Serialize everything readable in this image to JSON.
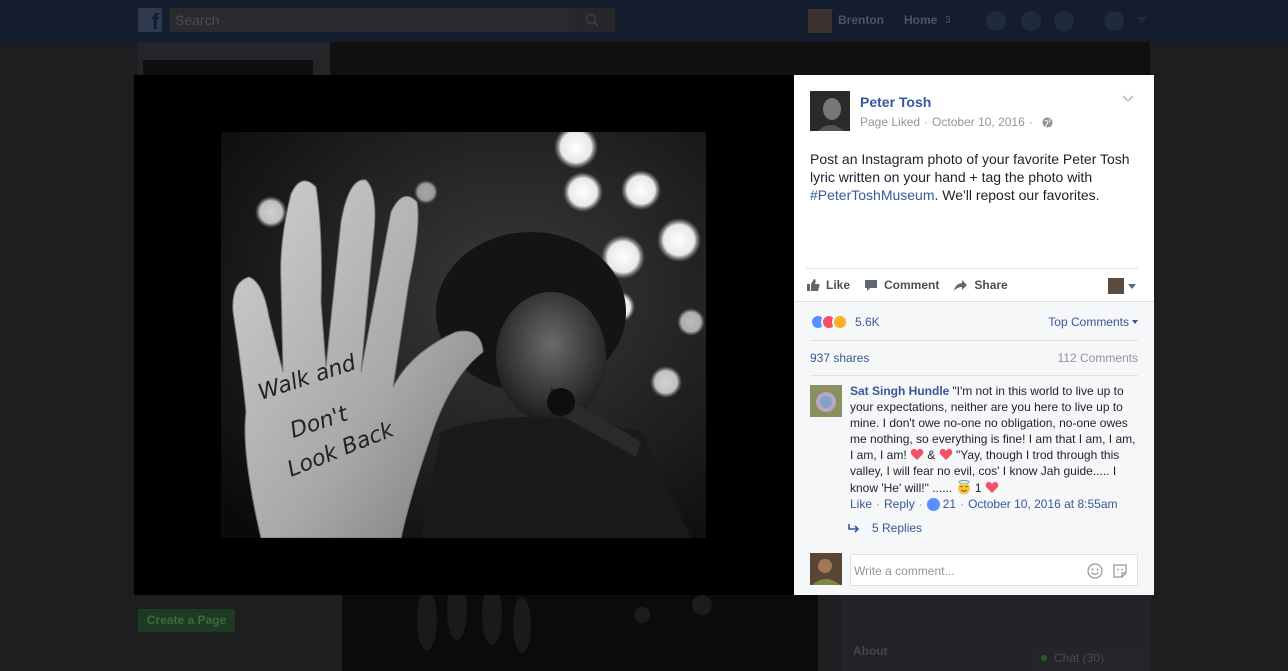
{
  "topbar": {
    "search_placeholder": "Search",
    "user_name": "Brenton",
    "home_label": "Home",
    "home_count": "3"
  },
  "background": {
    "create_page_label": "Create a Page",
    "about_label": "About",
    "chat_label": "Chat (30)"
  },
  "photo": {
    "palm_text_lines": [
      "Walk and",
      "Don't",
      "Look Back"
    ]
  },
  "post": {
    "author": "Peter Tosh",
    "meta_liked": "Page Liked",
    "meta_sep": "·",
    "meta_date": "October 10, 2016",
    "meta_sep2": "·",
    "text_before": "Post an Instagram photo of your favorite Peter Tosh lyric written on your hand + tag the photo with ",
    "hashtag": "#PeterToshMuseum",
    "text_after": ". We'll repost our favorites.",
    "icons": [
      "globe-icon",
      "chevron-down-icon"
    ]
  },
  "actions": {
    "like": "Like",
    "comment": "Comment",
    "share": "Share"
  },
  "stats": {
    "reactions_count": "5.6K",
    "top_comments": "Top Comments",
    "shares": "937 shares",
    "comments": "112 Comments"
  },
  "comment": {
    "author": "Sat Singh Hundle",
    "text_1": "\"I'm not in this world to live up to your expectations, neither are you here to live up to mine. I don't owe no-one no obligation, no-one owes me nothing, so everything is fine! I am that I am, I am, I am, I am! ",
    "amp": " & ",
    "text_2": " \"Yay, though I trod through this valley, I will fear no evil, cos' I know Jah guide..... I know 'He' will!\" ...... ",
    "text_3": " 1 ",
    "like": "Like",
    "reply": "Reply",
    "likes": "21",
    "sep": "·",
    "timestamp": "October 10, 2016 at 8:55am",
    "replies": "5 Replies"
  },
  "composer": {
    "placeholder": "Write a comment..."
  },
  "colors": {
    "link": "#365899",
    "like_blue": "#5890ff",
    "love_red": "#f25268",
    "haha_yellow": "#f7b125"
  }
}
